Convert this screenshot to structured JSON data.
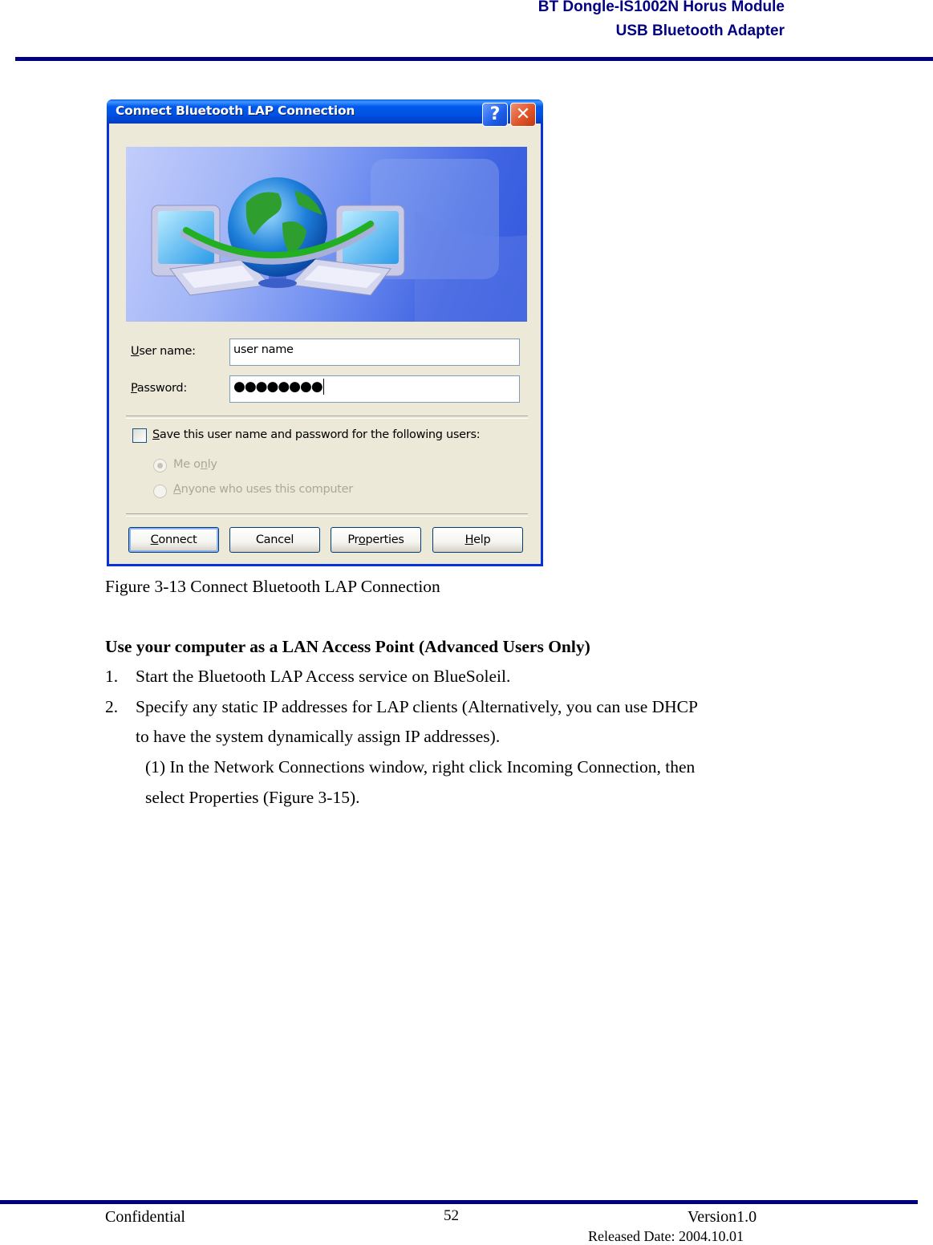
{
  "header": {
    "line1": "BT Dongle-IS1002N Horus Module",
    "line2": "USB Bluetooth Adapter",
    "rule_color": "#000080"
  },
  "dialog": {
    "title": "Connect Bluetooth LAP Connection",
    "help_icon": "?",
    "close_icon": "✕",
    "banner_image": "network-globe-laptops-illustration",
    "username_label_u": "U",
    "username_label_rest": "ser name:",
    "username_value": "user name",
    "password_label_u": "P",
    "password_label_rest": "assword:",
    "password_value": "●●●●●●●●",
    "save_checkbox_u": "S",
    "save_checkbox_rest": "ave this user name and password for the following users:",
    "save_checked": false,
    "radio_me_only_pre": "Me o",
    "radio_me_only_u": "n",
    "radio_me_only_post": "ly",
    "radio_me_only_selected": true,
    "radio_anyone_u": "A",
    "radio_anyone_rest": "nyone who uses this computer",
    "buttons": {
      "connect_u": "C",
      "connect_rest": "onnect",
      "cancel": "Cancel",
      "properties_pre": "Pr",
      "properties_u": "o",
      "properties_post": "perties",
      "help_u": "H",
      "help_rest": "elp"
    }
  },
  "content": {
    "figure_caption": "Figure 3-13 Connect Bluetooth LAP Connection",
    "section_heading": "Use your computer as a LAN Access Point (Advanced Users Only)",
    "steps": [
      {
        "num": "1.",
        "lines": [
          "Start the Bluetooth LAP Access service on BlueSoleil."
        ]
      },
      {
        "num": "2.",
        "lines": [
          "Specify any static IP addresses for LAP clients (Alternatively, you can use DHCP",
          "to have the system dynamically assign IP addresses)."
        ]
      }
    ],
    "substep": {
      "lines": [
        "(1) In the Network Connections window, right click Incoming Connection, then",
        "select Properties (Figure 3-15)."
      ]
    }
  },
  "footer": {
    "left": "Confidential",
    "page_number": "52",
    "version": "Version1.0",
    "released": "Released Date: 2004.10.01"
  }
}
